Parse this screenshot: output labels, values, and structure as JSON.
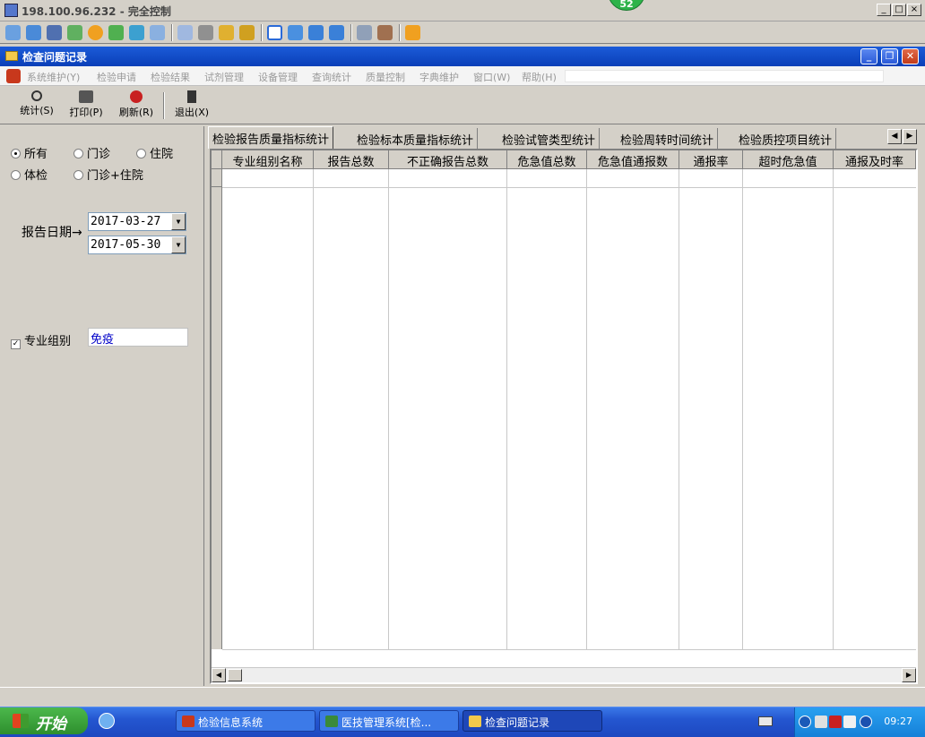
{
  "remote": {
    "title": "198.100.96.232 - 完全控制",
    "badge": "52"
  },
  "window": {
    "title": "检查问题记录"
  },
  "menu": {
    "items": [
      "系统维护(Y)",
      "检验申请",
      "检验结果",
      "试剂管理",
      "设备管理",
      "查询统计",
      "质量控制",
      "字典维护",
      "窗口(W)",
      "帮助(H)"
    ]
  },
  "toolbar": {
    "stats": "统计(S)",
    "print": "打印(P)",
    "refresh": "刷新(R)",
    "exit": "退出(X)"
  },
  "filter": {
    "radios": [
      {
        "label": "所有",
        "checked": true
      },
      {
        "label": "门诊",
        "checked": false
      },
      {
        "label": "住院",
        "checked": false
      },
      {
        "label": "体检",
        "checked": false
      },
      {
        "label": "门诊+住院",
        "checked": false
      }
    ],
    "date_label": "报告日期→",
    "date_from": "2017-03-27",
    "date_to": "2017-05-30",
    "group_checkbox_label": "专业组别",
    "group_checked": true,
    "group_value": "免疫"
  },
  "tabs": [
    "检验报告质量指标统计",
    "检验标本质量指标统计",
    "检验试管类型统计",
    "检验周转时间统计",
    "检验质控项目统计"
  ],
  "grid": {
    "columns": [
      "专业组别名称",
      "报告总数",
      "不正确报告总数",
      "危急值总数",
      "危急值通报数",
      "通报率",
      "超时危急值",
      "通报及时率"
    ]
  },
  "taskbar": {
    "start": "开始",
    "tasks": [
      "检验信息系统",
      "医技管理系统[检...",
      "检查问题记录"
    ],
    "time": "09:27"
  },
  "colors": {
    "title_bar": "#0a3fb8",
    "taskbar": "#2456d0",
    "start_button": "#3f9b2f",
    "input_text": "#0000c8"
  }
}
